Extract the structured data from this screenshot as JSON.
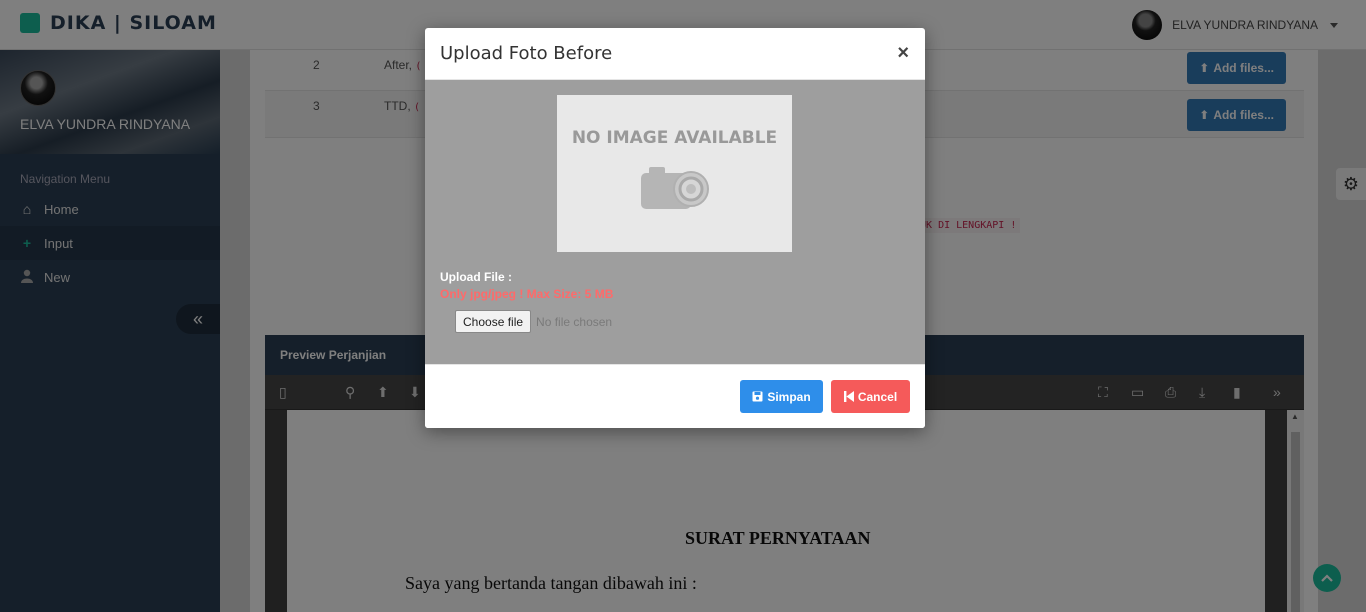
{
  "app": {
    "brand": "DIKA | SILOAM"
  },
  "header": {
    "user_name": "ELVA YUNDRA RINDYANA"
  },
  "sidebar": {
    "profile_name": "ELVA YUNDRA RINDYANA",
    "nav_title": "Navigation Menu",
    "items": [
      {
        "label": "Home",
        "icon": "home-icon"
      },
      {
        "label": "Input",
        "icon": "plus-icon"
      },
      {
        "label": "New",
        "icon": "user-icon"
      }
    ],
    "collapse_glyph": "«"
  },
  "table": {
    "rows": [
      {
        "no": "2",
        "desc": "After,",
        "code": "(",
        "button": "Add files..."
      },
      {
        "no": "3",
        "desc": "TTD,",
        "code": "(",
        "button": "Add files..."
      }
    ]
  },
  "note": "TUK DI LENGKAPI !",
  "preview": {
    "header": "Preview Perjanjian",
    "doc_title": "SURAT PERNYATAAN",
    "doc_line": "Saya yang bertanda tangan dibawah ini :"
  },
  "modal": {
    "title": "Upload Foto Before",
    "close": "×",
    "no_image_text": "NO IMAGE AVAILABLE",
    "upload_label": "Upload File :",
    "upload_note": "Only jpg/jpeg ! Max Size: 5 MB",
    "choose_file": "Choose file",
    "no_file": "No file chosen",
    "save_label": "Simpan",
    "cancel_label": "Cancel"
  },
  "colors": {
    "sidebar": "#2a3f54",
    "primary": "#2e8eea",
    "danger": "#f55a5a",
    "accent": "#1abc9c"
  }
}
